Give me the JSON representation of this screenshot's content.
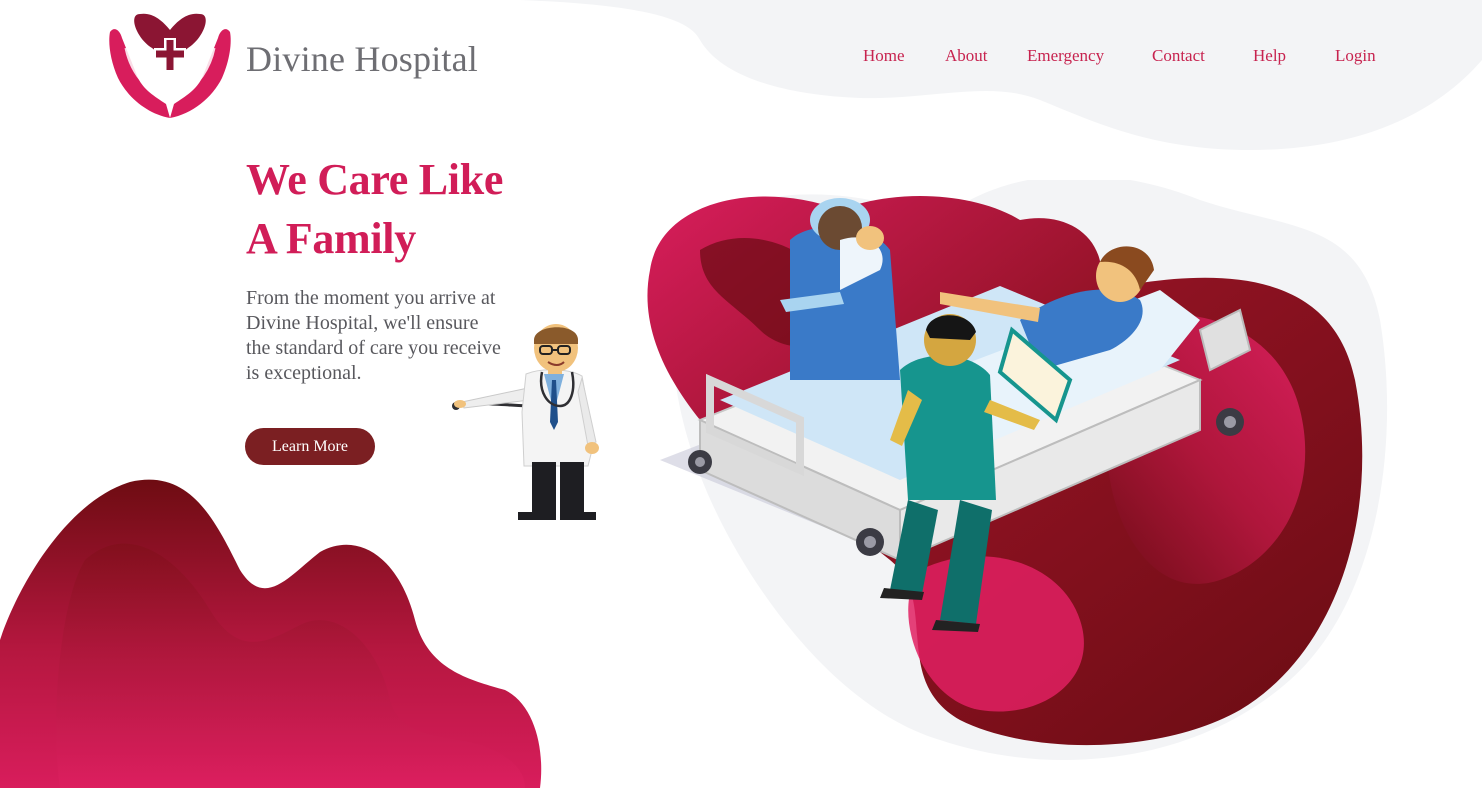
{
  "brand": {
    "name": "Divine Hospital"
  },
  "nav": {
    "items": [
      {
        "label": "Home"
      },
      {
        "label": "About"
      },
      {
        "label": "Emergency"
      },
      {
        "label": "Contact"
      },
      {
        "label": "Help"
      },
      {
        "label": "Login"
      }
    ]
  },
  "hero": {
    "title_line1": "We Care Like",
    "title_line2": "A Family",
    "description": "From the moment you arrive at Divine Hospital, we'll ensure the standard of care you receive is exceptional.",
    "cta_label": "Learn More"
  },
  "colors": {
    "accent": "#d11d58",
    "nav_text": "#c7234f",
    "brand_text": "#6e6e73",
    "button_bg": "#7b1f22",
    "crimson_dark": "#6e0c12",
    "blob_grey": "#f3f4f6"
  },
  "icons": {
    "logo": "heart-hands-cross-icon",
    "doctor": "doctor-stethoscope-illustration",
    "scene": "hospital-bed-nurses-illustration"
  }
}
